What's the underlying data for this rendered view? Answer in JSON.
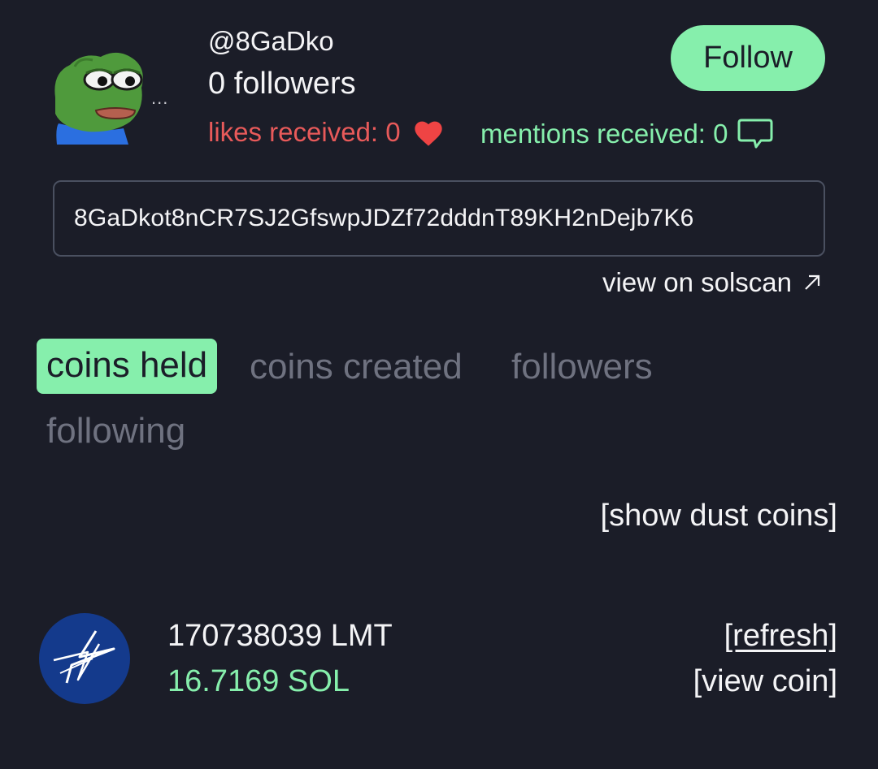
{
  "profile": {
    "handle": "@8GaDko",
    "followers": "0 followers",
    "follow_label": "Follow",
    "likes_received": "likes received: 0",
    "mentions_received": "mentions received: 0",
    "avatar_dots": "...",
    "avatar_icon": "frog-avatar-icon"
  },
  "address": {
    "value": "8GaDkot8nCR7SJ2GfswpJDZf72dddnT89KH2nDejb7K6",
    "solscan_label": "view on solscan"
  },
  "tabs": [
    {
      "label": "coins held",
      "active": true
    },
    {
      "label": "coins created",
      "active": false
    },
    {
      "label": "followers",
      "active": false
    },
    {
      "label": "following",
      "active": false
    }
  ],
  "dust_label": "[show dust coins]",
  "coins": [
    {
      "amount": "170738039 LMT",
      "sol_value": "16.7169 SOL",
      "refresh_label": "[refresh]",
      "view_label": "[view coin]",
      "logo_icon": "star-logo-icon"
    }
  ],
  "colors": {
    "background": "#1b1d28",
    "accent_green": "#86efac",
    "likes_red": "#e85a5a",
    "muted_tab": "#6f7280",
    "border": "#4a5060"
  }
}
